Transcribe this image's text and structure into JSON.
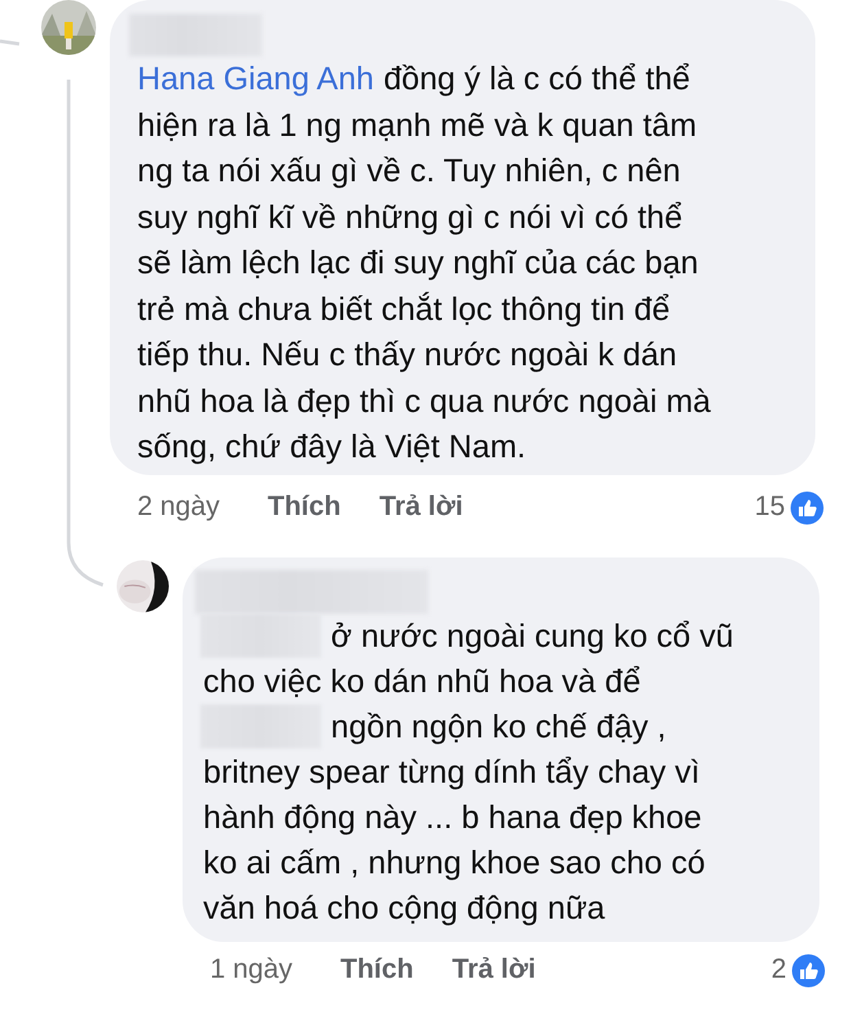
{
  "comments": [
    {
      "lines": [
        [
          {
            "kind": "mention",
            "text": "Hana Giang Anh"
          },
          {
            "kind": "text",
            "text": "đồng ý là c có thể thể"
          }
        ],
        [
          {
            "kind": "text",
            "text": "hiện ra là 1 ng mạnh mẽ và k quan tâm"
          }
        ],
        [
          {
            "kind": "text",
            "text": "ng ta nói xấu gì về c. Tuy nhiên, c nên"
          }
        ],
        [
          {
            "kind": "text",
            "text": "suy nghĩ kĩ về những gì c nói vì có thể"
          }
        ],
        [
          {
            "kind": "text",
            "text": "sẽ làm lệch lạc đi suy nghĩ của các bạn"
          }
        ],
        [
          {
            "kind": "text",
            "text": "trẻ mà chưa biết chắt lọc thông tin để"
          }
        ],
        [
          {
            "kind": "text",
            "text": "tiếp thu. Nếu c thấy nước ngoài k dán"
          }
        ],
        [
          {
            "kind": "text",
            "text": "nhũ hoa là đẹp thì c qua nước ngoài mà"
          }
        ],
        [
          {
            "kind": "text",
            "text": "sống, chứ đây là Việt Nam."
          }
        ]
      ],
      "time": "2 ngày",
      "like_label": "Thích",
      "reply_label": "Trả lời",
      "reaction_count": "15",
      "replies": [
        {
          "lines": [
            [
              {
                "kind": "redacted"
              },
              {
                "kind": "text",
                "text": "ở nước ngoài cung ko cổ vũ"
              }
            ],
            [
              {
                "kind": "text",
                "text": "cho việc ko dán nhũ hoa và để"
              }
            ],
            [
              {
                "kind": "redacted"
              },
              {
                "kind": "text",
                "text": "ngồn ngộn ko chế đậy ,"
              }
            ],
            [
              {
                "kind": "text",
                "text": "britney spear từng dính tẩy chay vì"
              }
            ],
            [
              {
                "kind": "text",
                "text": "hành động này ... b hana đẹp khoe"
              }
            ],
            [
              {
                "kind": "text",
                "text": "ko ai cấm , nhưng khoe sao cho có"
              }
            ],
            [
              {
                "kind": "text",
                "text": "văn hoá cho cộng động nữa"
              }
            ]
          ],
          "time": "1 ngày",
          "like_label": "Thích",
          "reply_label": "Trả lời",
          "reaction_count": "2"
        }
      ]
    }
  ]
}
